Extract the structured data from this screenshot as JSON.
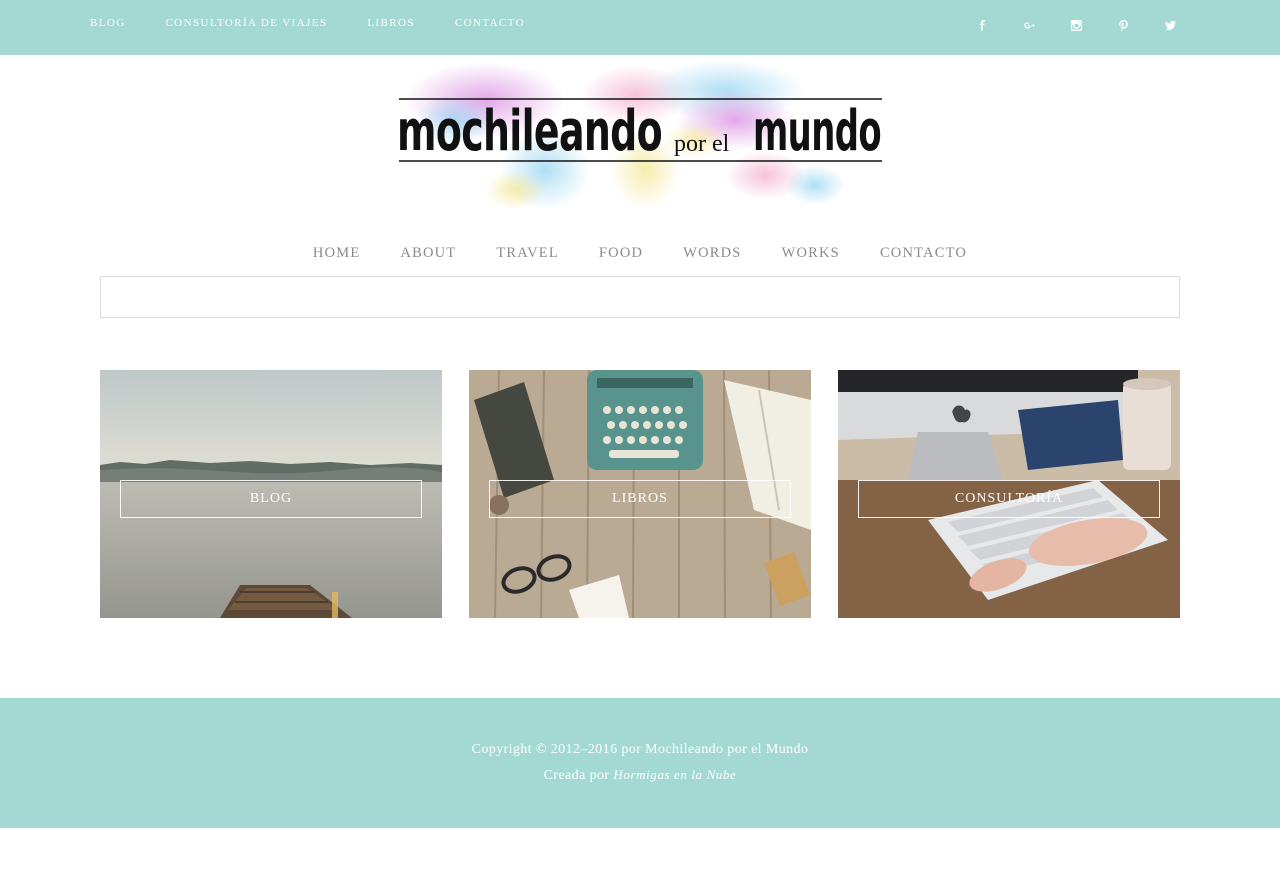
{
  "topnav": {
    "items": [
      "BLOG",
      "CONSULTORÍA DE VIAJES",
      "LIBROS",
      "CONTACTO"
    ]
  },
  "social": {
    "icons": [
      "facebook-icon",
      "google-plus-icon",
      "instagram-icon",
      "pinterest-icon",
      "twitter-icon"
    ]
  },
  "logo": {
    "line1": "mochileando",
    "line2": "por el",
    "line3": "mundo"
  },
  "mainnav": {
    "items": [
      "HOME",
      "ABOUT",
      "TRAVEL",
      "FOOD",
      "WORDS",
      "WORKS",
      "CONTACTO"
    ]
  },
  "search": {
    "placeholder": ""
  },
  "cards": [
    {
      "label": "BLOG"
    },
    {
      "label": "LIBROS"
    },
    {
      "label": "CONSULTORÍA"
    }
  ],
  "footer": {
    "copyright": "Copyright © 2012–2016 por Mochileando por el Mundo",
    "created_prefix": "Creada por",
    "created_by": "Hormigas en la Nube"
  },
  "colors": {
    "accent": "#a3d9d2",
    "nav_text": "#8a8a8a"
  }
}
